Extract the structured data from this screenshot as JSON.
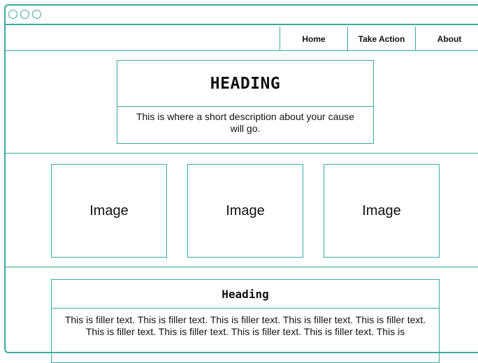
{
  "window": {
    "controls": [
      "circle-icon",
      "circle-icon",
      "circle-icon"
    ]
  },
  "nav": {
    "items": [
      {
        "label": "Home"
      },
      {
        "label": "Take Action"
      },
      {
        "label": "About"
      }
    ]
  },
  "hero": {
    "title": "HEADING",
    "description": "This is where a short description about your cause will go."
  },
  "images": [
    {
      "label": "Image"
    },
    {
      "label": "Image"
    },
    {
      "label": "Image"
    }
  ],
  "content": {
    "title": "Heading",
    "body": "This is filler text. This is filler text. This is filler text. This is filler text. This is filler text. This is filler text. This is filler text. This is filler text. This is filler text. This is"
  },
  "colors": {
    "accent": "#3aa9a0",
    "background": "#ffffff",
    "text": "#111111"
  }
}
